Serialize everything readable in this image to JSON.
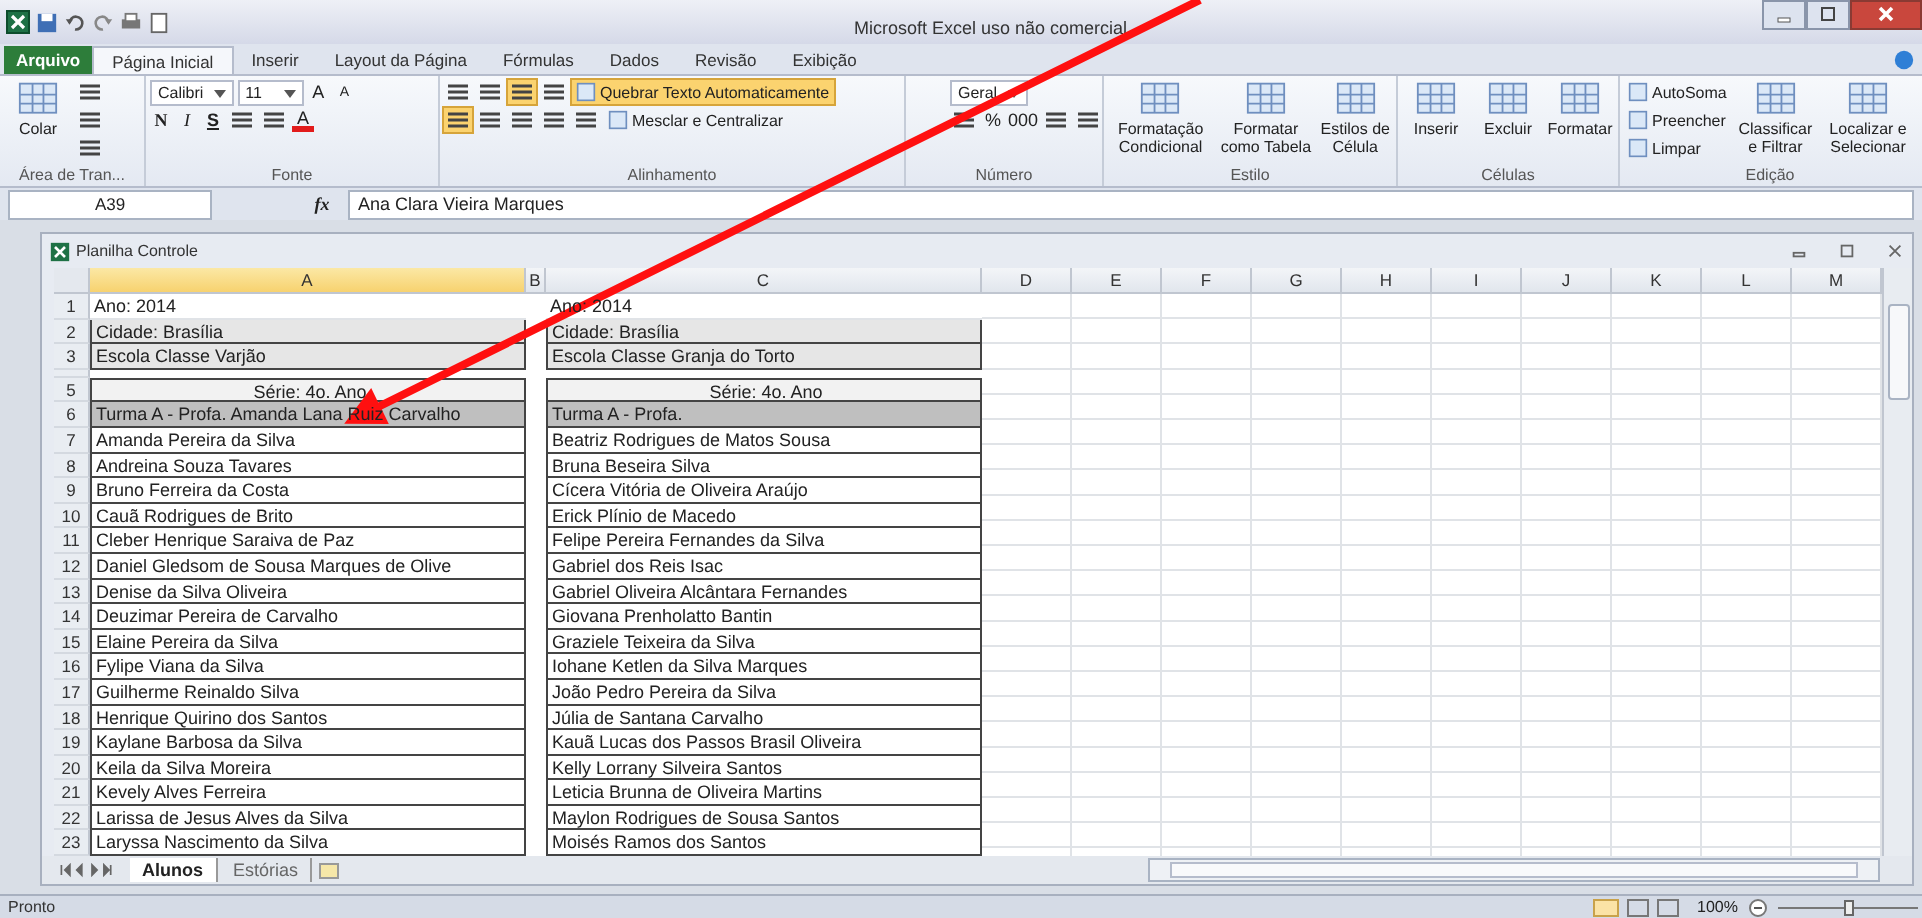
{
  "window": {
    "title": "Microsoft Excel uso não comercial"
  },
  "ribbon_tabs": [
    {
      "label": "Arquivo",
      "kind": "file",
      "selected": false
    },
    {
      "label": "Página Inicial",
      "kind": "tab",
      "selected": true
    },
    {
      "label": "Inserir",
      "kind": "tab",
      "selected": false
    },
    {
      "label": "Layout da Página",
      "kind": "tab",
      "selected": false
    },
    {
      "label": "Fórmulas",
      "kind": "tab",
      "selected": false
    },
    {
      "label": "Dados",
      "kind": "tab",
      "selected": false
    },
    {
      "label": "Revisão",
      "kind": "tab",
      "selected": false
    },
    {
      "label": "Exibição",
      "kind": "tab",
      "selected": false
    }
  ],
  "ribbon_groups": [
    {
      "label": "Área de Tran...",
      "parts": [
        {
          "kind": "large",
          "label": "Colar"
        },
        {
          "kind": "lines",
          "lines": [
            [
              {
                "kind": "icon"
              }
            ],
            [
              {
                "kind": "icon"
              }
            ],
            [
              {
                "kind": "icon"
              }
            ]
          ]
        }
      ]
    },
    {
      "label": "Fonte",
      "parts": [
        {
          "kind": "lines",
          "lines": [
            [
              {
                "kind": "field",
                "value": "Calibri"
              },
              {
                "kind": "field",
                "value": "11"
              },
              {
                "kind": "glyph",
                "text": "A"
              },
              {
                "kind": "shrink",
                "text": "A"
              }
            ],
            [
              {
                "kind": "bold",
                "text": "N"
              },
              {
                "kind": "italic",
                "text": "I"
              },
              {
                "kind": "underline",
                "text": "S"
              },
              {
                "kind": "icon"
              },
              {
                "kind": "icon"
              },
              {
                "kind": "fontcolor",
                "text": "A"
              }
            ]
          ]
        }
      ]
    },
    {
      "label": "Alinhamento",
      "parts": [
        {
          "kind": "lines",
          "lines": [
            [
              {
                "kind": "icon",
                "selected": false
              },
              {
                "kind": "icon",
                "selected": false
              },
              {
                "kind": "icon",
                "selected": true
              },
              {
                "kind": "icon",
                "selected": false
              },
              {
                "kind": "small",
                "label": "Quebrar Texto Automaticamente",
                "selected": true
              }
            ],
            [
              {
                "kind": "icon",
                "selected": true
              },
              {
                "kind": "icon",
                "selected": false
              },
              {
                "kind": "icon",
                "selected": false
              },
              {
                "kind": "icon",
                "selected": false
              },
              {
                "kind": "icon",
                "selected": false
              },
              {
                "kind": "small",
                "label": "Mesclar e Centralizar",
                "selected": false
              }
            ]
          ]
        }
      ]
    },
    {
      "label": "Número",
      "parts": [
        {
          "kind": "lines",
          "lines": [
            [
              {
                "kind": "field",
                "value": "Geral"
              }
            ],
            [
              {
                "kind": "icon"
              },
              {
                "kind": "glyph",
                "text": "%"
              },
              {
                "kind": "glyph",
                "text": "000"
              },
              {
                "kind": "icon"
              },
              {
                "kind": "icon"
              }
            ]
          ]
        }
      ]
    },
    {
      "label": "Estilo",
      "parts": [
        {
          "kind": "large",
          "label": "Formatação Condicional"
        },
        {
          "kind": "large",
          "label": "Formatar como Tabela"
        },
        {
          "kind": "large",
          "label": "Estilos de Célula"
        }
      ]
    },
    {
      "label": "Células",
      "parts": [
        {
          "kind": "large",
          "label": "Inserir"
        },
        {
          "kind": "large",
          "label": "Excluir"
        },
        {
          "kind": "large",
          "label": "Formatar"
        }
      ]
    },
    {
      "label": "Edição",
      "parts": [
        {
          "kind": "lines",
          "lines": [
            [
              {
                "kind": "small",
                "label": "AutoSoma"
              }
            ],
            [
              {
                "kind": "small",
                "label": "Preencher"
              }
            ],
            [
              {
                "kind": "small",
                "label": "Limpar"
              }
            ]
          ]
        },
        {
          "kind": "large",
          "label": "Classificar e Filtrar"
        },
        {
          "kind": "large",
          "label": "Localizar e Selecionar"
        }
      ]
    }
  ],
  "formula_bar": {
    "name_box": "A39",
    "fx": "fx",
    "value": "Ana Clara Vieira Marques"
  },
  "workbook": {
    "title": "Planilha Controle",
    "columns": [
      {
        "label": "A",
        "selected": true
      },
      {
        "label": "B",
        "selected": false
      },
      {
        "label": "C",
        "selected": false
      },
      {
        "label": "D",
        "selected": false
      },
      {
        "label": "E",
        "selected": false
      },
      {
        "label": "F",
        "selected": false
      },
      {
        "label": "G",
        "selected": false
      },
      {
        "label": "H",
        "selected": false
      },
      {
        "label": "I",
        "selected": false
      },
      {
        "label": "J",
        "selected": false
      },
      {
        "label": "K",
        "selected": false
      },
      {
        "label": "L",
        "selected": false
      },
      {
        "label": "M",
        "selected": false
      }
    ],
    "rows": [
      {
        "number": "1",
        "kind": "plain",
        "a": "Ano: 2014",
        "c": "Ano: 2014"
      },
      {
        "number": "2",
        "kind": "shaded",
        "a": "Cidade: Brasília",
        "c": "Cidade: Brasília"
      },
      {
        "number": "3",
        "kind": "shaded",
        "a": "Escola Classe Varjão",
        "c": "Escola Classe Granja do Torto"
      },
      {
        "kind": "spacer"
      },
      {
        "number": "5",
        "kind": "centered",
        "a": "Série: 4o. Ano",
        "c": "Série: 4o. Ano"
      },
      {
        "number": "6",
        "kind": "header",
        "a": "Turma A - Profa. Amanda Lana Ruiz Carvalho",
        "c": "Turma A - Profa."
      },
      {
        "number": "7",
        "kind": "name",
        "a": "Amanda Pereira da Silva",
        "c": "Beatriz Rodrigues de Matos Sousa"
      },
      {
        "number": "8",
        "kind": "name",
        "a": "Andreina Souza Tavares",
        "c": "Bruna Beseira Silva"
      },
      {
        "number": "9",
        "kind": "name",
        "a": "Bruno Ferreira da Costa",
        "c": "Cícera Vitória de Oliveira Araújo"
      },
      {
        "number": "10",
        "kind": "name",
        "a": "Cauã Rodrigues de Brito",
        "c": "Erick Plínio de Macedo"
      },
      {
        "number": "11",
        "kind": "name",
        "a": "Cleber Henrique Saraiva de Paz",
        "c": "Felipe Pereira Fernandes da Silva"
      },
      {
        "number": "12",
        "kind": "name",
        "a": "Daniel Gledsom de Sousa Marques de Olive",
        "c": "Gabriel dos Reis Isac"
      },
      {
        "number": "13",
        "kind": "name",
        "a": "Denise da Silva Oliveira",
        "c": "Gabriel Oliveira Alcântara Fernandes"
      },
      {
        "number": "14",
        "kind": "name",
        "a": "Deuzimar Pereira de Carvalho",
        "c": "Giovana Prenholatto Bantin"
      },
      {
        "number": "15",
        "kind": "name",
        "a": "Elaine Pereira da Silva",
        "c": "Graziele Teixeira da Silva"
      },
      {
        "number": "16",
        "kind": "name",
        "a": "Fylipe Viana da Silva",
        "c": "Iohane Ketlen da Silva Marques"
      },
      {
        "number": "17",
        "kind": "name",
        "a": "Guilherme Reinaldo Silva",
        "c": "João Pedro Pereira da Silva"
      },
      {
        "number": "18",
        "kind": "name",
        "a": "Henrique Quirino dos Santos",
        "c": "Júlia de Santana Carvalho"
      },
      {
        "number": "19",
        "kind": "name",
        "a": "Kaylane Barbosa da Silva",
        "c": "Kauã Lucas dos Passos Brasil Oliveira"
      },
      {
        "number": "20",
        "kind": "name",
        "a": "Keila da Silva Moreira",
        "c": "Kelly Lorrany Silveira Santos"
      },
      {
        "number": "21",
        "kind": "name",
        "a": "Kevely Alves Ferreira",
        "c": "Leticia Brunna de Oliveira Martins"
      },
      {
        "number": "22",
        "kind": "name",
        "a": "Larissa de Jesus Alves da Silva",
        "c": "Maylon Rodrigues de Sousa Santos"
      },
      {
        "number": "23",
        "kind": "name",
        "a": "Laryssa Nascimento da Silva",
        "c": "Moisés Ramos dos Santos"
      }
    ],
    "sheet_tabs": [
      {
        "label": "Alunos",
        "selected": true
      },
      {
        "label": "Estórias",
        "selected": false
      }
    ]
  },
  "status_bar": {
    "text": "Pronto",
    "zoom": "100%",
    "zoom_slider": {
      "level": 0.5
    }
  }
}
